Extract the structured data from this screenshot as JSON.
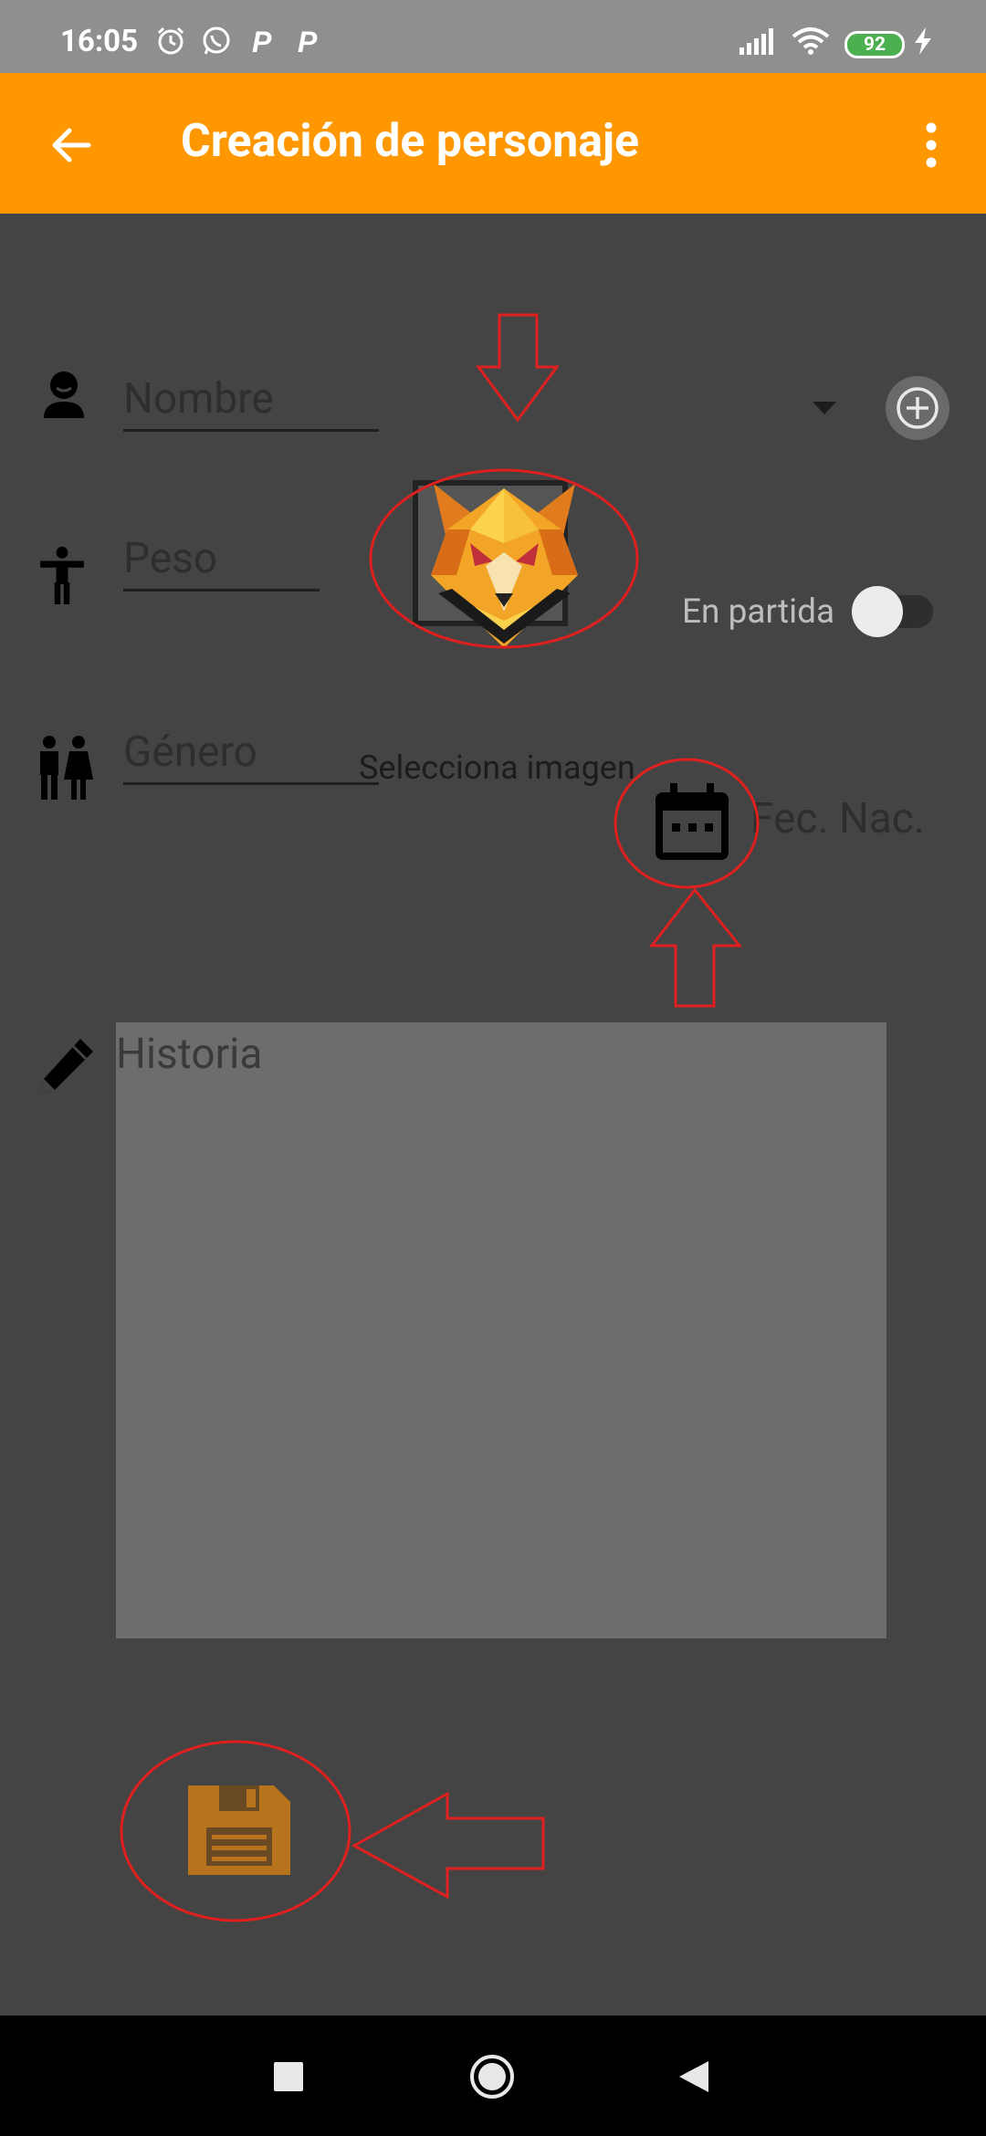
{
  "status_bar": {
    "time": "16:05",
    "battery": "92",
    "icons": [
      "alarm-icon",
      "whatsapp-icon",
      "parking-icon",
      "parking-icon",
      "signal-icon",
      "wifi-icon",
      "battery-icon",
      "charging-icon"
    ]
  },
  "app_bar": {
    "title": "Creación de personaje",
    "back_icon": "arrow-back-icon",
    "menu_icon": "more-vert-icon",
    "color": "#ff9800"
  },
  "form": {
    "nombre_placeholder": "Nombre",
    "peso_placeholder": "Peso",
    "genero_placeholder": "Género",
    "select_image_label": "Selecciona imagen",
    "en_partida_label": "En partida",
    "en_partida_on": false,
    "fec_nac_label": "Fec. Nac.",
    "historia_placeholder": "Historia"
  },
  "colors": {
    "accent": "#ff9800",
    "background": "#444444",
    "annotation": "#e01f1f"
  }
}
